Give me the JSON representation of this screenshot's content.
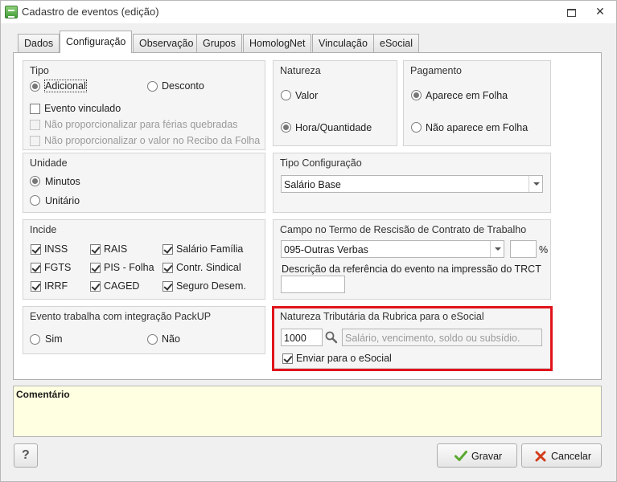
{
  "window": {
    "title": "Cadastro de eventos (edição)"
  },
  "tabs": [
    "Dados",
    "Configuração",
    "Observação",
    "Grupos",
    "HomologNet",
    "Vinculação",
    "eSocial"
  ],
  "tipo": {
    "title": "Tipo",
    "adicional": "Adicional",
    "desconto": "Desconto",
    "evento_vinculado": "Evento vinculado",
    "nao_prop_ferias": "Não proporcionalizar para férias quebradas",
    "nao_prop_recibo": "Não proporcionalizar o valor no Recibo da Folha"
  },
  "natureza": {
    "title": "Natureza",
    "valor": "Valor",
    "hora_quantidade": "Hora/Quantidade"
  },
  "pagamento": {
    "title": "Pagamento",
    "aparece": "Aparece em Folha",
    "nao_aparece": "Não aparece em Folha"
  },
  "unidade": {
    "title": "Unidade",
    "minutos": "Minutos",
    "unitario": "Unitário"
  },
  "tipo_config": {
    "title": "Tipo Configuração",
    "value": "Salário Base"
  },
  "incide": {
    "title": "Incide",
    "items": [
      "INSS",
      "RAIS",
      "Salário Família",
      "FGTS",
      "PIS - Folha",
      "Contr. Sindical",
      "IRRF",
      "CAGED",
      "Seguro Desem."
    ]
  },
  "campo_trct": {
    "title": "Campo no Termo de Rescisão de Contrato de Trabalho",
    "value": "095-Outras Verbas",
    "percent": "%",
    "descricao_label": "Descrição da referência do evento na impressão do TRCT",
    "descricao_value": ""
  },
  "packup": {
    "title": "Evento trabalha com integração PackUP",
    "sim": "Sim",
    "nao": "Não"
  },
  "esocial": {
    "title": "Natureza Tributária da Rubrica para o eSocial",
    "code": "1000",
    "description_placeholder": "Salário, vencimento, soldo ou subsídio.",
    "enviar": "Enviar para o eSocial"
  },
  "comment": {
    "label": "Comentário"
  },
  "buttons": {
    "help": "?",
    "gravar": "Gravar",
    "cancelar": "Cancelar"
  },
  "colors": {
    "highlight": "#e0141c",
    "comment_bg": "#ffffe1",
    "gravar_check": "#5aa82e",
    "cancel_x": "#d23c1a"
  }
}
